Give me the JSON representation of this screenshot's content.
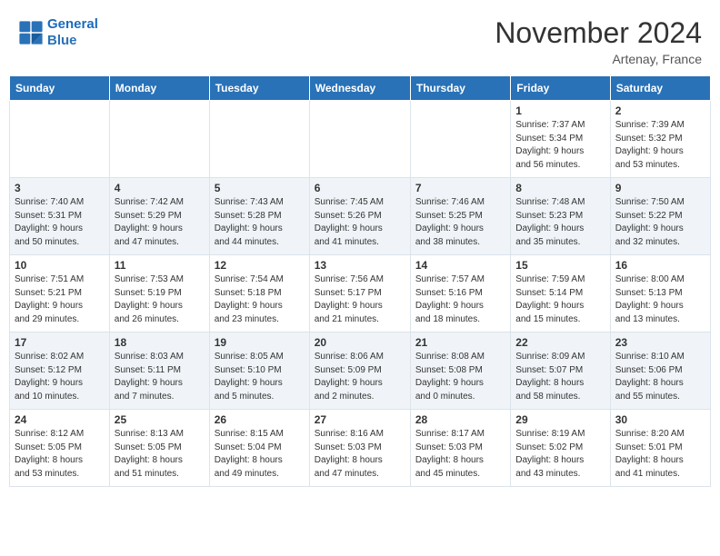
{
  "header": {
    "logo_line1": "General",
    "logo_line2": "Blue",
    "month": "November 2024",
    "location": "Artenay, France"
  },
  "weekdays": [
    "Sunday",
    "Monday",
    "Tuesday",
    "Wednesday",
    "Thursday",
    "Friday",
    "Saturday"
  ],
  "weeks": [
    [
      {
        "day": "",
        "info": ""
      },
      {
        "day": "",
        "info": ""
      },
      {
        "day": "",
        "info": ""
      },
      {
        "day": "",
        "info": ""
      },
      {
        "day": "",
        "info": ""
      },
      {
        "day": "1",
        "info": "Sunrise: 7:37 AM\nSunset: 5:34 PM\nDaylight: 9 hours\nand 56 minutes."
      },
      {
        "day": "2",
        "info": "Sunrise: 7:39 AM\nSunset: 5:32 PM\nDaylight: 9 hours\nand 53 minutes."
      }
    ],
    [
      {
        "day": "3",
        "info": "Sunrise: 7:40 AM\nSunset: 5:31 PM\nDaylight: 9 hours\nand 50 minutes."
      },
      {
        "day": "4",
        "info": "Sunrise: 7:42 AM\nSunset: 5:29 PM\nDaylight: 9 hours\nand 47 minutes."
      },
      {
        "day": "5",
        "info": "Sunrise: 7:43 AM\nSunset: 5:28 PM\nDaylight: 9 hours\nand 44 minutes."
      },
      {
        "day": "6",
        "info": "Sunrise: 7:45 AM\nSunset: 5:26 PM\nDaylight: 9 hours\nand 41 minutes."
      },
      {
        "day": "7",
        "info": "Sunrise: 7:46 AM\nSunset: 5:25 PM\nDaylight: 9 hours\nand 38 minutes."
      },
      {
        "day": "8",
        "info": "Sunrise: 7:48 AM\nSunset: 5:23 PM\nDaylight: 9 hours\nand 35 minutes."
      },
      {
        "day": "9",
        "info": "Sunrise: 7:50 AM\nSunset: 5:22 PM\nDaylight: 9 hours\nand 32 minutes."
      }
    ],
    [
      {
        "day": "10",
        "info": "Sunrise: 7:51 AM\nSunset: 5:21 PM\nDaylight: 9 hours\nand 29 minutes."
      },
      {
        "day": "11",
        "info": "Sunrise: 7:53 AM\nSunset: 5:19 PM\nDaylight: 9 hours\nand 26 minutes."
      },
      {
        "day": "12",
        "info": "Sunrise: 7:54 AM\nSunset: 5:18 PM\nDaylight: 9 hours\nand 23 minutes."
      },
      {
        "day": "13",
        "info": "Sunrise: 7:56 AM\nSunset: 5:17 PM\nDaylight: 9 hours\nand 21 minutes."
      },
      {
        "day": "14",
        "info": "Sunrise: 7:57 AM\nSunset: 5:16 PM\nDaylight: 9 hours\nand 18 minutes."
      },
      {
        "day": "15",
        "info": "Sunrise: 7:59 AM\nSunset: 5:14 PM\nDaylight: 9 hours\nand 15 minutes."
      },
      {
        "day": "16",
        "info": "Sunrise: 8:00 AM\nSunset: 5:13 PM\nDaylight: 9 hours\nand 13 minutes."
      }
    ],
    [
      {
        "day": "17",
        "info": "Sunrise: 8:02 AM\nSunset: 5:12 PM\nDaylight: 9 hours\nand 10 minutes."
      },
      {
        "day": "18",
        "info": "Sunrise: 8:03 AM\nSunset: 5:11 PM\nDaylight: 9 hours\nand 7 minutes."
      },
      {
        "day": "19",
        "info": "Sunrise: 8:05 AM\nSunset: 5:10 PM\nDaylight: 9 hours\nand 5 minutes."
      },
      {
        "day": "20",
        "info": "Sunrise: 8:06 AM\nSunset: 5:09 PM\nDaylight: 9 hours\nand 2 minutes."
      },
      {
        "day": "21",
        "info": "Sunrise: 8:08 AM\nSunset: 5:08 PM\nDaylight: 9 hours\nand 0 minutes."
      },
      {
        "day": "22",
        "info": "Sunrise: 8:09 AM\nSunset: 5:07 PM\nDaylight: 8 hours\nand 58 minutes."
      },
      {
        "day": "23",
        "info": "Sunrise: 8:10 AM\nSunset: 5:06 PM\nDaylight: 8 hours\nand 55 minutes."
      }
    ],
    [
      {
        "day": "24",
        "info": "Sunrise: 8:12 AM\nSunset: 5:05 PM\nDaylight: 8 hours\nand 53 minutes."
      },
      {
        "day": "25",
        "info": "Sunrise: 8:13 AM\nSunset: 5:05 PM\nDaylight: 8 hours\nand 51 minutes."
      },
      {
        "day": "26",
        "info": "Sunrise: 8:15 AM\nSunset: 5:04 PM\nDaylight: 8 hours\nand 49 minutes."
      },
      {
        "day": "27",
        "info": "Sunrise: 8:16 AM\nSunset: 5:03 PM\nDaylight: 8 hours\nand 47 minutes."
      },
      {
        "day": "28",
        "info": "Sunrise: 8:17 AM\nSunset: 5:03 PM\nDaylight: 8 hours\nand 45 minutes."
      },
      {
        "day": "29",
        "info": "Sunrise: 8:19 AM\nSunset: 5:02 PM\nDaylight: 8 hours\nand 43 minutes."
      },
      {
        "day": "30",
        "info": "Sunrise: 8:20 AM\nSunset: 5:01 PM\nDaylight: 8 hours\nand 41 minutes."
      }
    ]
  ]
}
